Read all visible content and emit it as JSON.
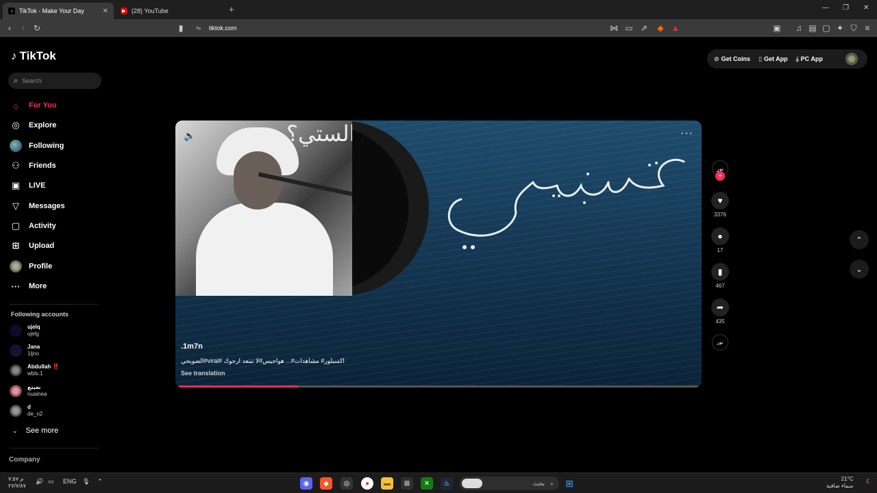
{
  "browser": {
    "tabs": [
      {
        "title": "TikTok - Make Your Day",
        "active": true
      },
      {
        "title": "(28) YouTube",
        "active": false
      }
    ],
    "url": "tiktok.com"
  },
  "sidebar": {
    "brand": "TikTok",
    "search_placeholder": "Search",
    "nav": [
      {
        "label": "For You",
        "icon": "home-icon"
      },
      {
        "label": "Explore",
        "icon": "compass-icon"
      },
      {
        "label": "Following",
        "icon": "avatar"
      },
      {
        "label": "Friends",
        "icon": "friends-icon"
      },
      {
        "label": "LIVE",
        "icon": "live-icon"
      },
      {
        "label": "Messages",
        "icon": "paper-plane-icon"
      },
      {
        "label": "Activity",
        "icon": "activity-icon"
      },
      {
        "label": "Upload",
        "icon": "upload-icon"
      },
      {
        "label": "Profile",
        "icon": "avatar"
      },
      {
        "label": "More",
        "icon": "more-icon"
      }
    ],
    "following_title": "Following accounts",
    "accounts": [
      {
        "name": "ujelq",
        "handle": "ujelg"
      },
      {
        "name": "Jana",
        "handle": "1ljno"
      },
      {
        "name": "Abdullah ‼️",
        "handle": "wbls.1"
      },
      {
        "name": "نعيتع",
        "handle": "nuainea"
      },
      {
        "name": "d",
        "handle": "de_n2"
      }
    ],
    "see_more": "See more",
    "company": "Company"
  },
  "top_actions": {
    "coins": "Get Coins",
    "app": "Get App",
    "pc_app": "PC App"
  },
  "video": {
    "author": ".1m7n",
    "caption": "الضويحي#viral# اكسبلور# مشاهدات#... هواجيس#لا تبتعد ارجوك",
    "see_translation": "See translation",
    "overlay_text": "الستي؟",
    "progress": 0.23
  },
  "actions": {
    "likes": "3376",
    "comments": "17",
    "saves": "467",
    "shares": "435"
  },
  "taskbar": {
    "time": "م ٧:٥٧",
    "date": "٢٧/٧/٨٧",
    "lang": "ENG",
    "search": "بحث",
    "temp": "21°C",
    "weather": "سماء صافية"
  },
  "colors": {
    "accent": "#fe2c55"
  }
}
